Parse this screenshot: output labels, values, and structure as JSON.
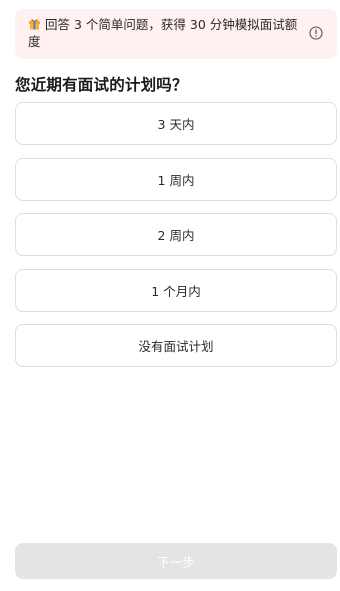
{
  "banner": {
    "icon": "gift-icon",
    "text": "回答 3 个简单问题，获得 30 分钟模拟面试额度",
    "info_icon": "info-icon"
  },
  "question": {
    "title": "您近期有面试的计划吗？"
  },
  "options": [
    {
      "label": "3 天内"
    },
    {
      "label": "1 周内"
    },
    {
      "label": "2 周内"
    },
    {
      "label": "1 个月内"
    },
    {
      "label": "没有面试计划"
    }
  ],
  "footer": {
    "next_label": "下一步",
    "next_enabled": false
  },
  "colors": {
    "banner_bg": "#fff1f2",
    "option_border": "#dedede",
    "next_disabled_bg": "#e4e4e4"
  }
}
